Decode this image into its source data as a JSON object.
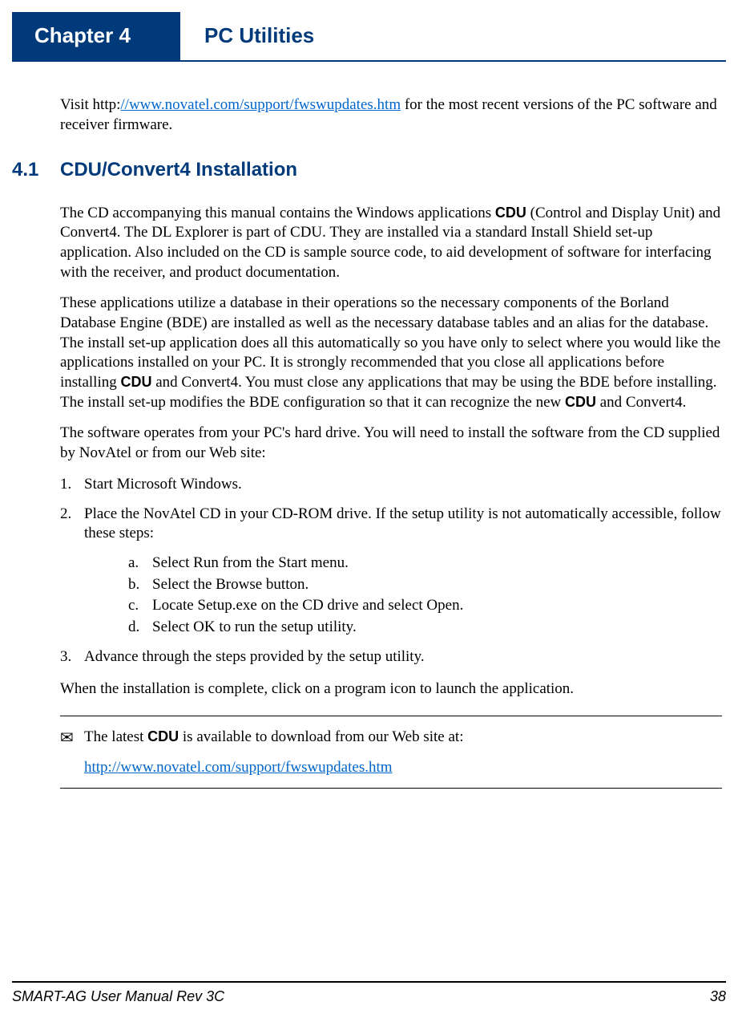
{
  "header": {
    "chapter_label": "Chapter 4",
    "chapter_title": "PC Utilities"
  },
  "intro": {
    "pre": "Visit http:",
    "link": "//www.novatel.com/support/fwswupdates.htm",
    "post": " for the most recent versions of the PC software and receiver firmware."
  },
  "section": {
    "number": "4.1",
    "title": "CDU/Convert4 Installation"
  },
  "para1": {
    "a": "The CD accompanying this manual contains the Windows applications ",
    "b": "CDU",
    "c": " (Control and Display Unit) and Convert4. The DL Explorer is part of CDU. They are installed via a standard Install Shield set-up application. Also included on the CD is sample source code, to aid development of software for interfacing with the receiver, and product documentation."
  },
  "para2": {
    "a": "These applications utilize a database in their operations so the necessary components of the Borland Database Engine (BDE) are installed as well as the necessary database tables and an alias for the database. The install set-up application does all this automatically so you have only to select where you would like the applications installed on your PC. It is strongly recommended that you close all applications before installing ",
    "b": "CDU",
    "c": " and Convert4. You must close any applications that may be using the BDE before installing. The install set-up modifies the BDE configuration so that it can recognize the new ",
    "d": "CDU",
    "e": " and Convert4."
  },
  "para3": "The software operates from your PC's hard drive. You will need to install the software from the CD supplied by NovAtel or from our Web site:",
  "list": {
    "item1": {
      "num": "1.",
      "text": "Start Microsoft Windows."
    },
    "item2": {
      "num": "2.",
      "text": "Place the NovAtel CD in your CD-ROM drive. If the setup utility is not automatically accessible, follow these steps:"
    },
    "sub": {
      "a": {
        "num": "a.",
        "text": "Select Run from the Start menu."
      },
      "b": {
        "num": "b.",
        "text": "Select the Browse button."
      },
      "c": {
        "num": "c.",
        "text": "Locate Setup.exe on the CD drive and select Open."
      },
      "d": {
        "num": "d.",
        "text": "Select OK to run the setup utility."
      }
    },
    "item3": {
      "num": "3.",
      "text": "Advance through the steps provided by the setup utility."
    }
  },
  "after_list": "When the installation is complete, click on a program icon to launch the application.",
  "note": {
    "icon": "✉",
    "pre": "The latest ",
    "bold": "CDU",
    "post": " is available to download from our Web site at:",
    "link": "http://www.novatel.com/support/fwswupdates.htm"
  },
  "footer": {
    "left": "SMART-AG User Manual Rev 3C",
    "right": "38"
  }
}
